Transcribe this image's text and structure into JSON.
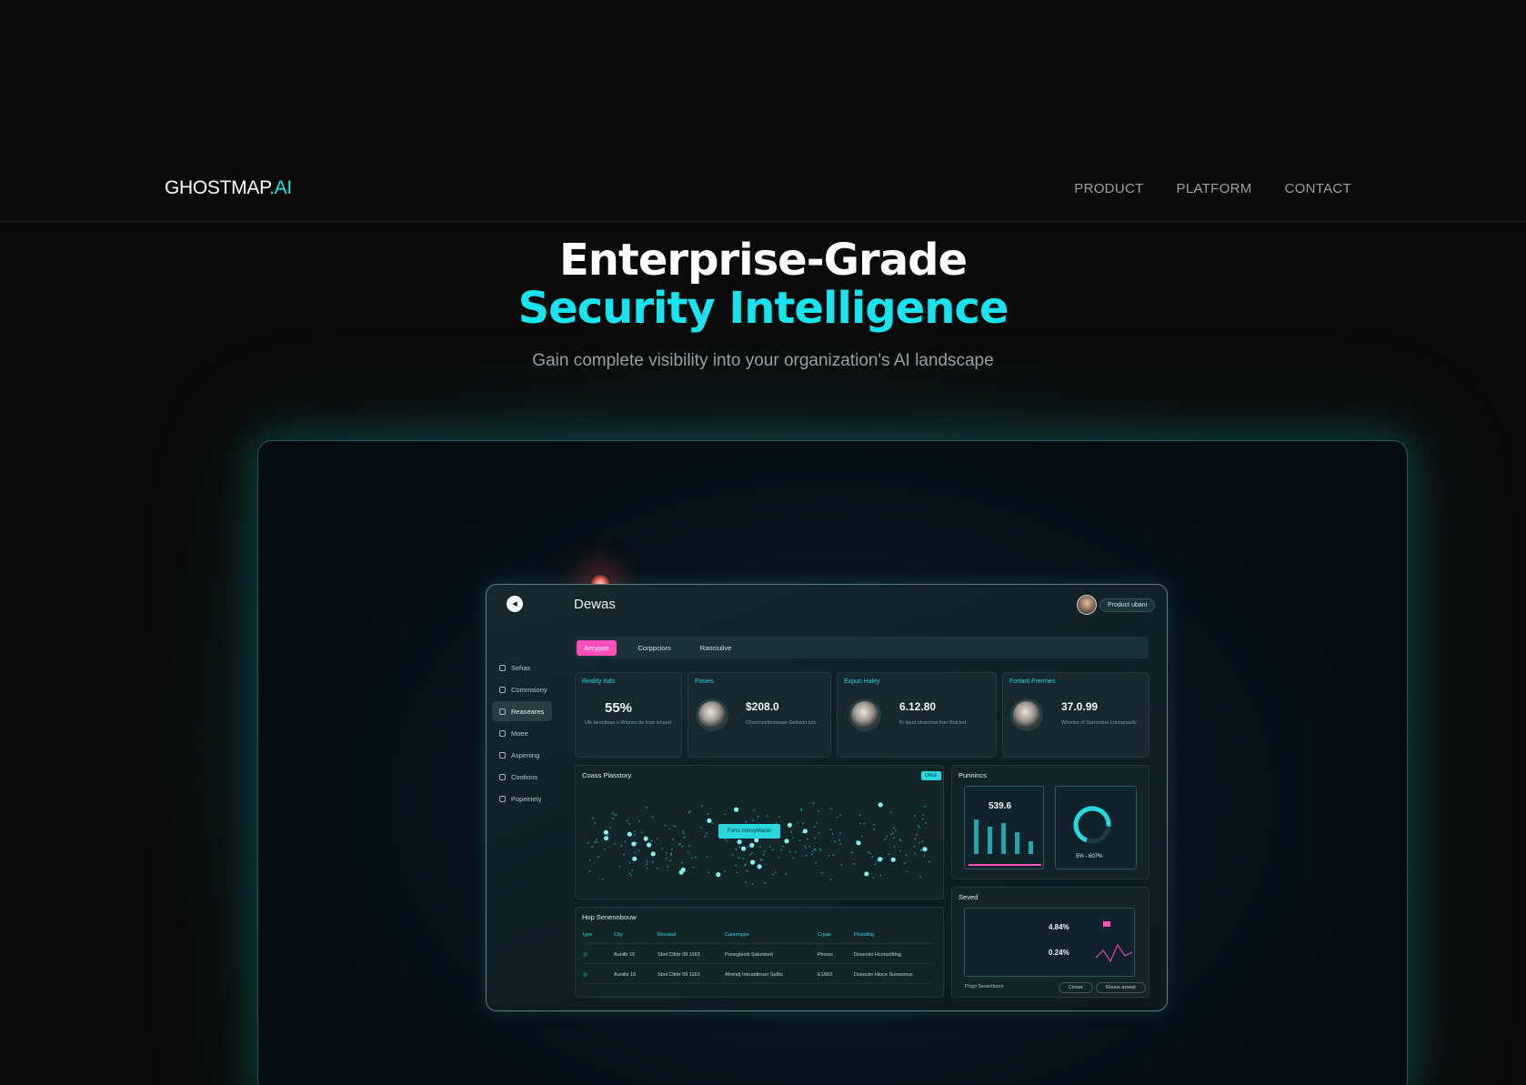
{
  "brand": {
    "name_main": "GHOSTMAP",
    "name_accent": ".AI",
    "accent_color": "#19e3ee"
  },
  "nav": {
    "items": [
      "PRODUCT",
      "PLATFORM",
      "CONTACT"
    ]
  },
  "hero": {
    "title_line1": "Enterprise-Grade",
    "title_line2": "Security Intelligence",
    "subtitle": "Gain complete visibility into your organization's AI landscape"
  },
  "dashboard": {
    "title": "Dewas",
    "user_label": "Product ubani",
    "sidebar": [
      "Sehas",
      "Commsiony",
      "Reaseares",
      "Moee",
      "Aspening",
      "Coolions",
      "Popeiriety"
    ],
    "sidebar_active_index": 2,
    "tabs": [
      "Aerypos",
      "Corppciors",
      "Ranciulive"
    ],
    "active_tab_index": 0,
    "cards": [
      {
        "title": "Reality Isds",
        "value": "55%",
        "desc": "Ulk bencttose o Wiones tto lose ionsed"
      },
      {
        "title": "Fosies",
        "value": "$208.0",
        "desc": "Chonmestinossaer Gelision tolc"
      },
      {
        "title": "Expuri Haley",
        "value": "6.12.80",
        "desc": "Bi Ipiud strasome foer Bolcted"
      },
      {
        "title": "Fortant Frerrnes",
        "value": "37.0.99",
        "desc": "Witonks of Sarnostoe Lunsanasilo"
      }
    ],
    "map_panel": {
      "title": "Coass Plasstory",
      "badge": "ONLE",
      "button": "Fonu nnnoyMacer"
    },
    "right_panel": {
      "title": "Punnincs",
      "value": "539.6",
      "ring_label": "5% - 607%"
    },
    "table_panel": {
      "title": "Hop Senennbouw",
      "headers": [
        "Iype",
        "City",
        "Rensted",
        "Cannmppe",
        "Crgae",
        "Plssidlng"
      ],
      "rows": [
        [
          "",
          "Auniltr 16",
          "Sbol Cllrbr 09 1163",
          "Presrgleisb Satunbert",
          "Ptnoss",
          "Dosectin Hcorsolldng"
        ],
        [
          "",
          "Aunilts 16",
          "Sbol Cllrbr 09 1163",
          "Afrendj Intruodinuer Sufbs",
          "E1663",
          "Dosectin Hioce Suresonus"
        ]
      ]
    },
    "bottom_right": {
      "title": "Seved",
      "metric1": "4.84%",
      "metric2": "0.24%",
      "btn1": "Cinser",
      "btn2": "Roues arnest",
      "footer_tag": "Prigo Seoerttionn"
    }
  }
}
